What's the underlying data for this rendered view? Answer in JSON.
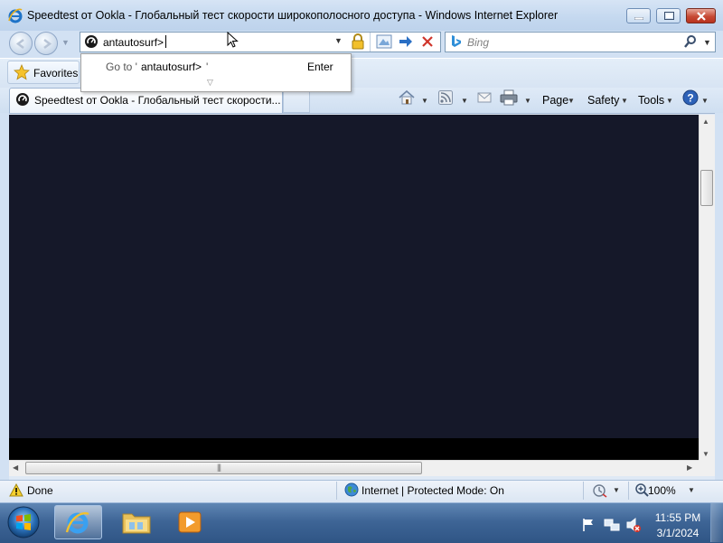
{
  "window": {
    "title": "Speedtest от Ookla - Глобальный тест скорости широкополосного доступа - Windows Internet Explorer"
  },
  "address_bar": {
    "value": "antautosurf>"
  },
  "search": {
    "placeholder": "Bing"
  },
  "favorites_bar": {
    "favorites_label": "Favorites"
  },
  "autocomplete": {
    "goto_prefix": "Go to '",
    "goto_url": "antautosurf>",
    "goto_suffix": "'",
    "enter_hint": "Enter"
  },
  "tabs": [
    {
      "label": "Speedtest от Ookla - Глобальный тест скорости..."
    }
  ],
  "command_bar": {
    "page_label": "Page",
    "safety_label": "Safety",
    "tools_label": "Tools"
  },
  "status_bar": {
    "status_text": "Done",
    "zone_text": "Internet | Protected Mode: On",
    "zoom": "100%"
  },
  "taskbar": {
    "time": "11:55 PM",
    "date": "3/1/2024"
  },
  "colors": {
    "content_background": "#151829",
    "taskbar": "#3e6596",
    "close_button": "#c74a35"
  }
}
